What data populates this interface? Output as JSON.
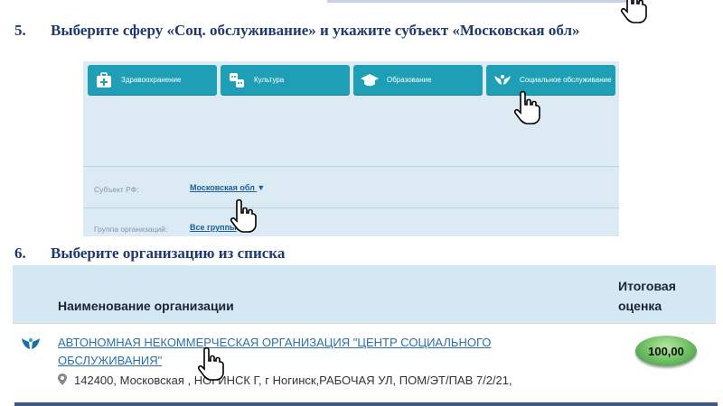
{
  "steps": [
    {
      "number": "5.",
      "text": "Выберите сферу «Соц. обслуживание» и укажите субъект «Московская обл»"
    },
    {
      "number": "6.",
      "text": "Выберите организацию из списка"
    }
  ],
  "panel": {
    "sectors": [
      {
        "label": "Здравоохранение",
        "icon": "medical-bag-icon"
      },
      {
        "label": "Культура",
        "icon": "theater-masks-icon"
      },
      {
        "label": "Образование",
        "icon": "graduation-cap-icon"
      },
      {
        "label": "Социальное обслуживание",
        "icon": "caring-hands-icon"
      }
    ],
    "region_label": "Субъект РФ:",
    "region_value": "Московская обл",
    "group_label": "Группа организаций:",
    "group_value": "Все группы"
  },
  "table": {
    "col_name": "Наименование организации",
    "col_score_line1": "Итоговая",
    "col_score_line2": "оценка",
    "row": {
      "name_line1": "АВТОНОМНАЯ НЕКОММЕРЧЕСКАЯ ОРГАНИЗАЦИЯ \"ЦЕНТР СОЦИАЛЬНОГО",
      "name_line2": "ОБСЛУЖИВАНИЯ\"",
      "address": "142400, Московская , НОГИНСК Г, г Ногинск,РАБОЧАЯ УЛ, ПОМ/ЭТ/ПАВ 7/2/21,",
      "score": "100,00",
      "icon": "caring-hands-icon"
    }
  },
  "colors": {
    "accent": "#1e9fb6",
    "heading": "#1f3a70",
    "link": "#2c6fb0",
    "panel_bg": "#dcebf3"
  }
}
